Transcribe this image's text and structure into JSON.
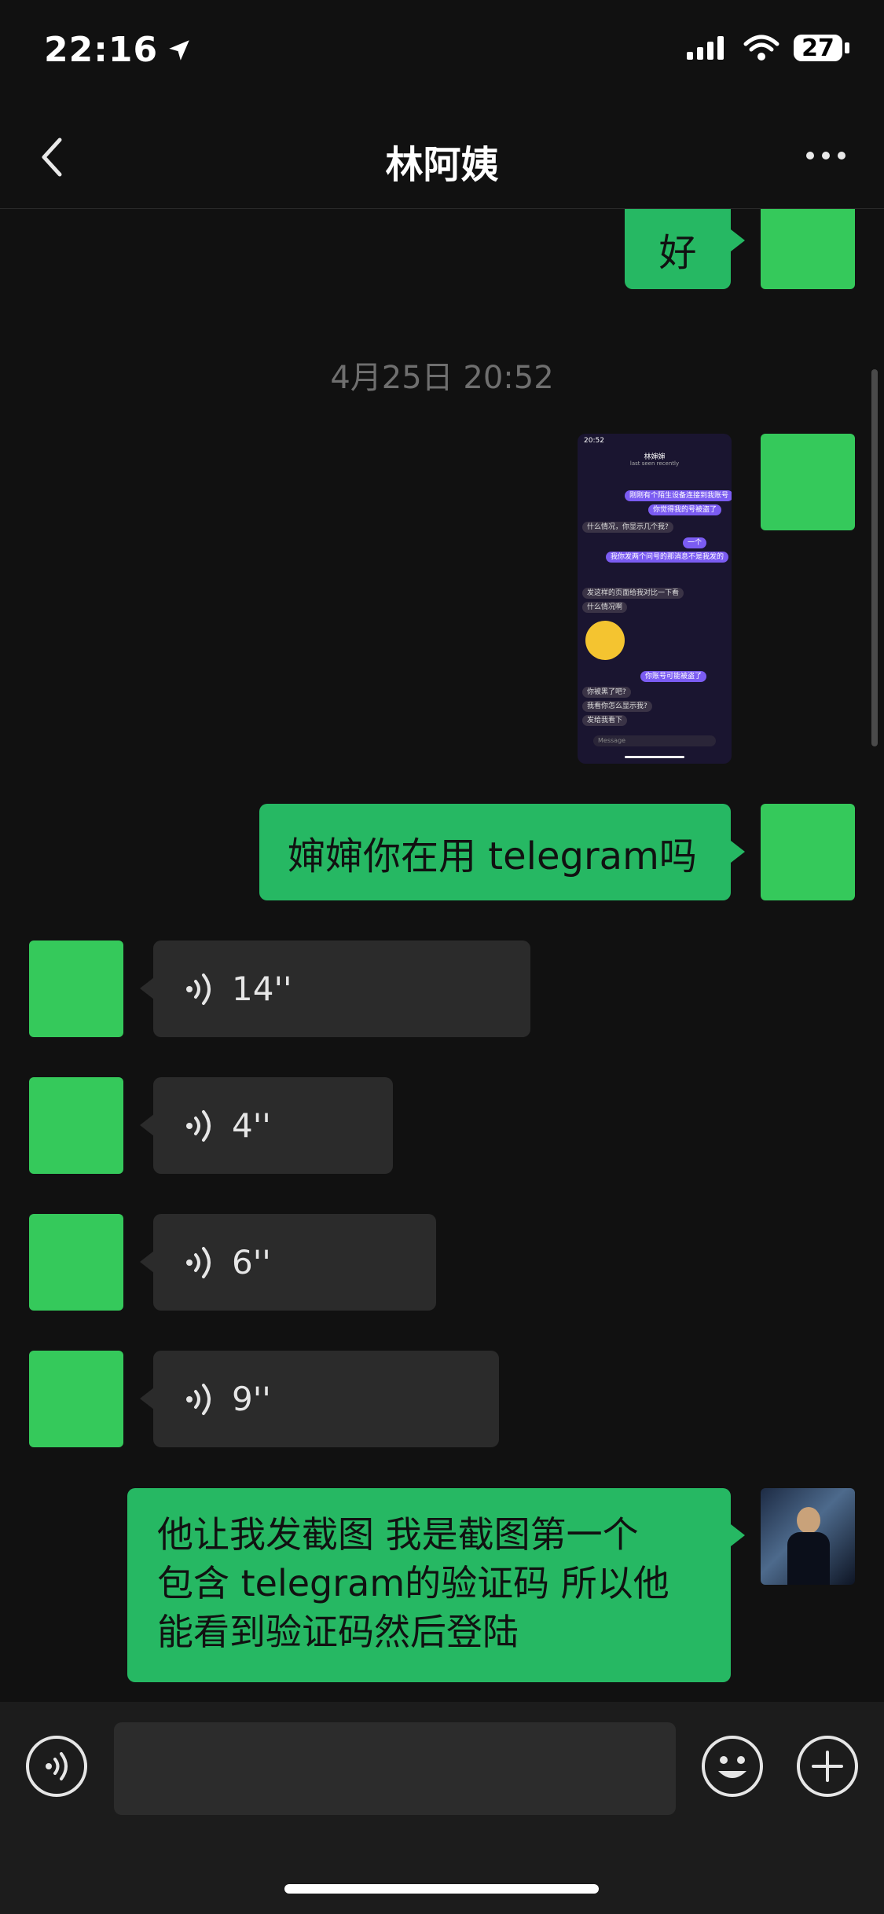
{
  "status": {
    "time": "22:16",
    "battery": "27"
  },
  "header": {
    "title": "林阿姨"
  },
  "timestamp": "4月25日 20:52",
  "messages": {
    "m1": "好",
    "m3": "婶婶你在用 telegram吗",
    "voice1": "14''",
    "voice2": "4''",
    "voice3": "6''",
    "voice4": "9''",
    "m4_line1": "他让我发截图 我是截图第一个",
    "m4_line2": "包含 telegram的验证码 所以他",
    "m4_line3": "能看到验证码然后登陆"
  },
  "screenshot": {
    "time": "20:52",
    "title": "林婶婶",
    "subtitle": "last seen recently",
    "input_placeholder": "Message",
    "lines": [
      "刚刚有个陌生设备连接到我账号",
      "你觉得我的号被盗了",
      "什么情况，你显示几个我?",
      "一个",
      "我你发两个问号的那消息不是我发的",
      "发这样的页面给我对比一下看",
      "什么情况啊",
      "你账号可能被盗了",
      "你被黑了吧?",
      "我看你怎么显示我?",
      "发给我看下"
    ]
  },
  "colors": {
    "accent": "#26b863",
    "avatar": "#35c95b",
    "background": "#111111"
  }
}
